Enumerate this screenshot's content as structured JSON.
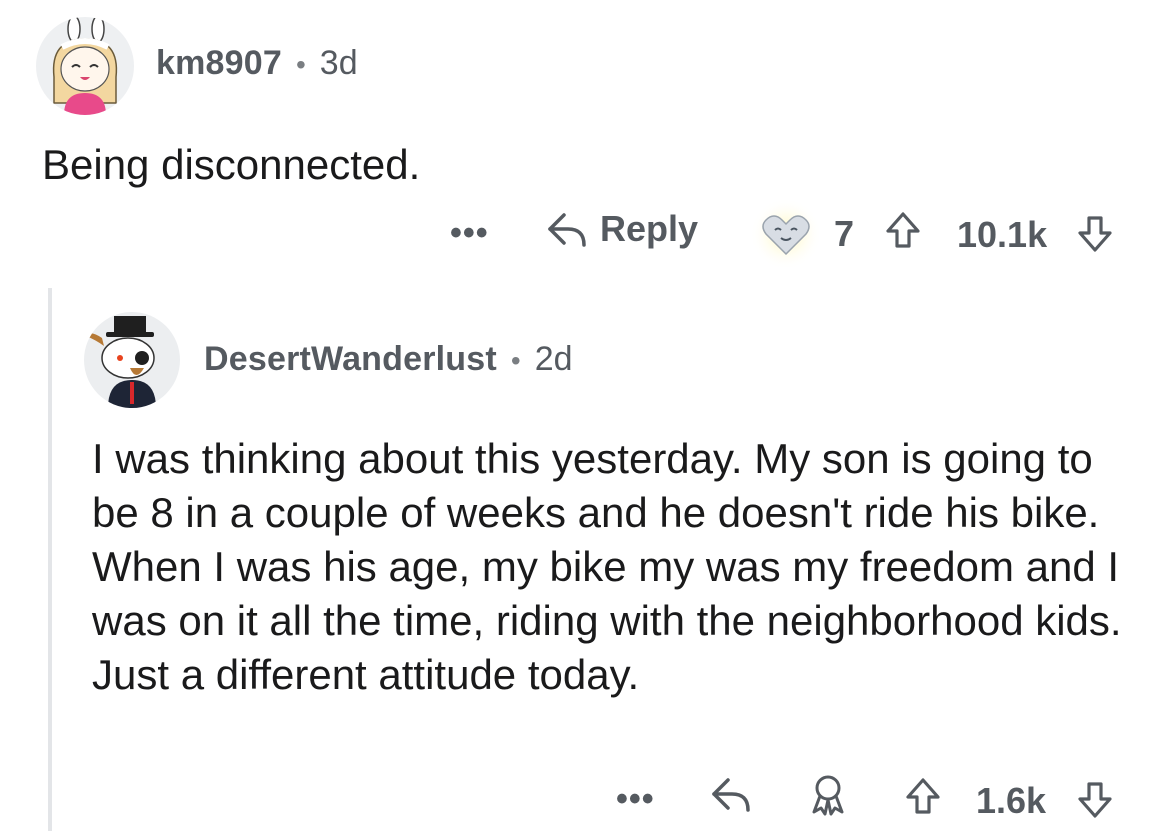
{
  "comment": {
    "username": "km8907",
    "separator": "•",
    "age": "3d",
    "body": "Being disconnected.",
    "actions": {
      "more_label": "•••",
      "reply_label": "Reply",
      "award_count": "7",
      "score": "10.1k"
    }
  },
  "reply": {
    "username": "DesertWanderlust",
    "separator": "•",
    "age": "2d",
    "body": "I was thinking about this yesterday. My son is going to be 8 in a couple of weeks and he doesn't ride his bike. When I was his age, my bike my was my freedom and I was on it all the time, riding with the neighborhood kids. Just a different attitude today.",
    "actions": {
      "more_label": "•••",
      "score": "1.6k"
    }
  },
  "icons": {
    "avatar_top": "avatar-anime-girl-bunny-hat",
    "avatar_reply": "avatar-snoo-top-hat",
    "award": "heart-eyes-award-icon",
    "reply": "reply-arrow-icon",
    "upvote": "upvote-arrow-icon",
    "downvote": "downvote-arrow-icon",
    "award_give": "award-ribbon-icon"
  },
  "colors": {
    "text": "#1a1a1b",
    "meta": "#555a60",
    "thread_line": "#e3e5e8"
  }
}
